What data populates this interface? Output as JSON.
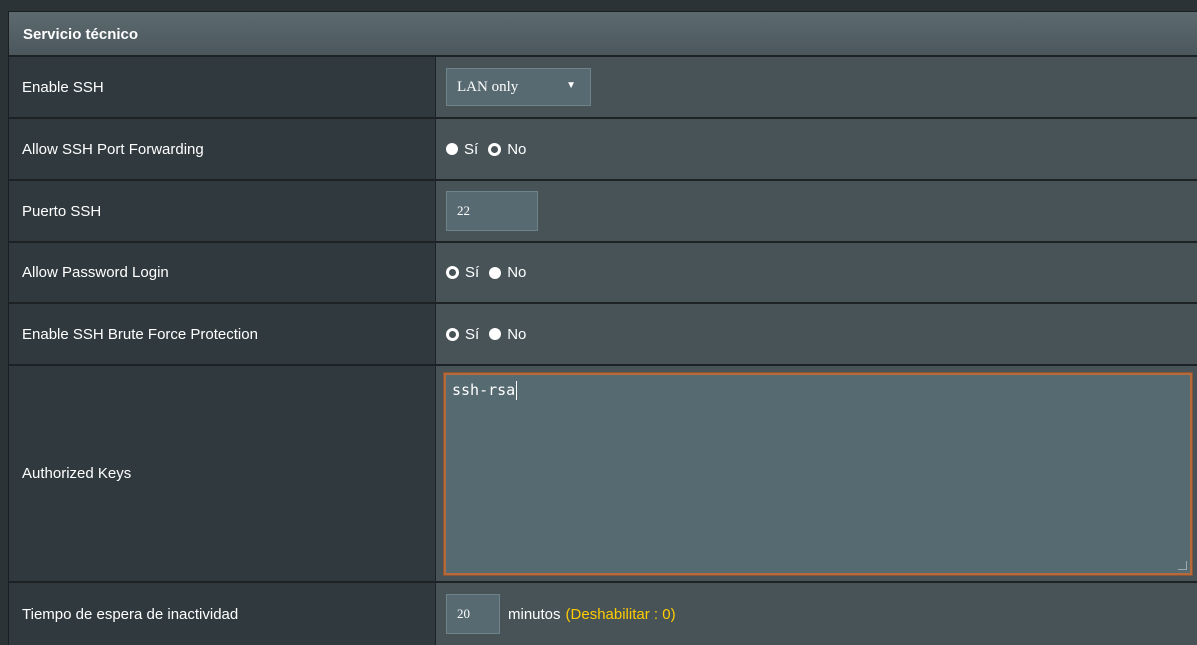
{
  "panel": {
    "title": "Servicio técnico"
  },
  "rows": {
    "enable_ssh": {
      "label": "Enable SSH",
      "selected": "LAN only"
    },
    "ssh_port_forwarding": {
      "label": "Allow SSH Port Forwarding",
      "options": [
        "Sí",
        "No"
      ],
      "selected": "No"
    },
    "ssh_port": {
      "label": "Puerto SSH",
      "value": "22"
    },
    "password_login": {
      "label": "Allow Password Login",
      "options": [
        "Sí",
        "No"
      ],
      "selected": "Sí"
    },
    "brute_force": {
      "label": "Enable SSH Brute Force Protection",
      "options": [
        "Sí",
        "No"
      ],
      "selected": "Sí"
    },
    "authorized_keys": {
      "label": "Authorized Keys",
      "value": "ssh-rsa"
    },
    "idle_timeout": {
      "label": "Tiempo de espera de inactividad",
      "value": "20",
      "unit": "minutos",
      "hint": "(Deshabilitar : 0)"
    }
  },
  "colors": {
    "header": "#4b575c",
    "label_bg": "#303a3e",
    "value_bg": "#475357",
    "focus_border": "#b66a3a",
    "hint": "#ffcc00"
  },
  "icons": {
    "dropdown": "caret-down-icon"
  }
}
